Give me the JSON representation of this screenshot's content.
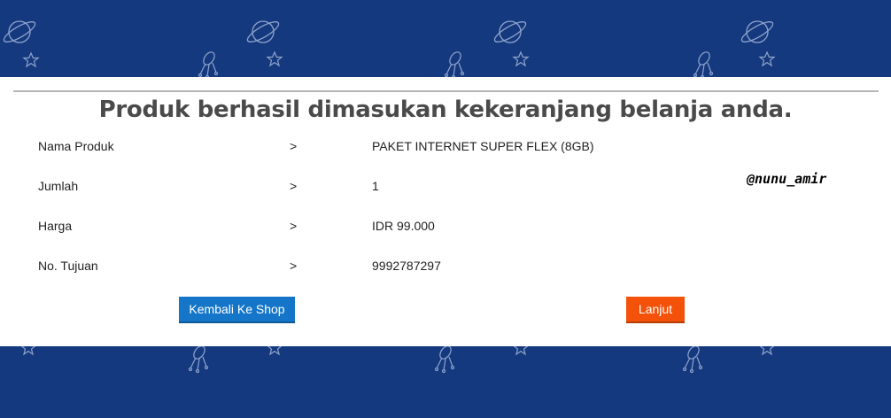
{
  "colors": {
    "background": "#15397e",
    "panel": "#ffffff",
    "primary_button": "#1576c9",
    "accent_button": "#f4520a"
  },
  "header": {
    "title": "Produk berhasil dimasukan kekeranjang belanja anda."
  },
  "details": [
    {
      "label": "Nama Produk",
      "separator": ">",
      "value": "PAKET INTERNET SUPER FLEX (8GB)"
    },
    {
      "label": "Jumlah",
      "separator": ">",
      "value": "1"
    },
    {
      "label": "Harga",
      "separator": ">",
      "value": "IDR 99.000"
    },
    {
      "label": "No. Tujuan",
      "separator": ">",
      "value": "9992787297"
    }
  ],
  "watermark": "@nunu_amir",
  "buttons": {
    "back_label": "Kembali Ke Shop",
    "next_label": "Lanjut"
  },
  "decor_icons": [
    "planet-icon",
    "star-icon",
    "satellite-icon"
  ]
}
